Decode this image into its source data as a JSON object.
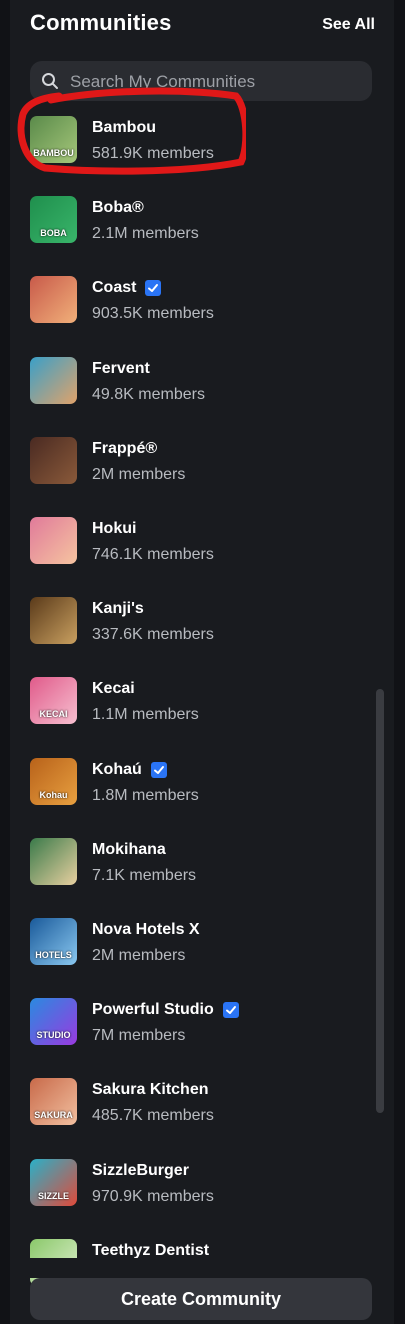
{
  "header": {
    "title": "Communities",
    "see_all_label": "See All"
  },
  "search": {
    "placeholder": "Search My Communities"
  },
  "communities": [
    {
      "name": "Bambou",
      "members": "581.9K members",
      "verified": false,
      "icon": "bambou-logo",
      "thumb_label": "BAMBOU",
      "thumb_colors": [
        "#5a8a4a",
        "#a5c77a"
      ]
    },
    {
      "name": "Boba®",
      "members": "2.1M members",
      "verified": false,
      "icon": "boba-logo",
      "thumb_label": "BOBA",
      "thumb_colors": [
        "#1f8f4d",
        "#39b56a"
      ]
    },
    {
      "name": "Coast",
      "members": "903.5K members",
      "verified": true,
      "icon": "coast-logo",
      "thumb_label": "",
      "thumb_colors": [
        "#c85a4a",
        "#f1b07a"
      ]
    },
    {
      "name": "Fervent",
      "members": "49.8K members",
      "verified": false,
      "icon": "fervent-logo",
      "thumb_label": "",
      "thumb_colors": [
        "#3aa0c8",
        "#e0a26a"
      ]
    },
    {
      "name": "Frappé®",
      "members": "2M members",
      "verified": false,
      "icon": "frappe-logo",
      "thumb_label": "",
      "thumb_colors": [
        "#4a2a22",
        "#8a5a3a"
      ]
    },
    {
      "name": "Hokui",
      "members": "746.1K members",
      "verified": false,
      "icon": "hokui-logo",
      "thumb_label": "",
      "thumb_colors": [
        "#e07a9a",
        "#f6c4a0"
      ]
    },
    {
      "name": "Kanji's",
      "members": "337.6K members",
      "verified": false,
      "icon": "kanjis-logo",
      "thumb_label": "",
      "thumb_colors": [
        "#5a3a1a",
        "#c9a060"
      ]
    },
    {
      "name": "Kecai",
      "members": "1.1M members",
      "verified": false,
      "icon": "kecai-logo",
      "thumb_label": "KECAI",
      "thumb_colors": [
        "#e05a8a",
        "#f7c0d0"
      ]
    },
    {
      "name": "Kohaú",
      "members": "1.8M members",
      "verified": true,
      "icon": "kohau-logo",
      "thumb_label": "Kohau",
      "thumb_colors": [
        "#b8621a",
        "#e8a040"
      ]
    },
    {
      "name": "Mokihana",
      "members": "7.1K members",
      "verified": false,
      "icon": "mokihana-logo",
      "thumb_label": "",
      "thumb_colors": [
        "#3a7a4a",
        "#e8d0a0"
      ]
    },
    {
      "name": "Nova Hotels X",
      "members": "2M members",
      "verified": false,
      "icon": "nova-hotels-logo",
      "thumb_label": "HOTELS",
      "thumb_colors": [
        "#1a5a9a",
        "#8ac8f0"
      ]
    },
    {
      "name": "Powerful Studio",
      "members": "7M members",
      "verified": true,
      "icon": "powerful-studio-logo",
      "thumb_label": "STUDIO",
      "thumb_colors": [
        "#2a8ae0",
        "#9a3ae0"
      ]
    },
    {
      "name": "Sakura Kitchen",
      "members": "485.7K members",
      "verified": false,
      "icon": "sakura-kitchen-logo",
      "thumb_label": "SAKURA",
      "thumb_colors": [
        "#c86a4a",
        "#f2c0a0"
      ]
    },
    {
      "name": "SizzleBurger",
      "members": "970.9K members",
      "verified": false,
      "icon": "sizzleburger-logo",
      "thumb_label": "SIZZLE",
      "thumb_colors": [
        "#2ab0c8",
        "#e04a3a"
      ]
    },
    {
      "name": "Teethyz Dentist",
      "members": "",
      "verified": false,
      "icon": "teethyz-logo",
      "thumb_label": "",
      "thumb_colors": [
        "#8ac86a",
        "#e0f0d0"
      ]
    }
  ],
  "footer": {
    "create_label": "Create Community"
  },
  "colors": {
    "verified": "#2a74f5",
    "highlight": "#e01818",
    "panel": "#191b1f"
  }
}
